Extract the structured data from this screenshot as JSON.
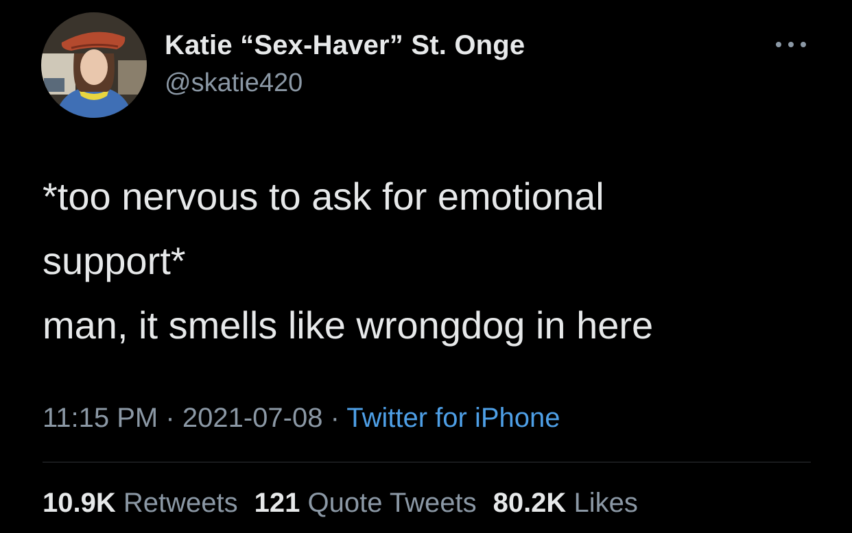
{
  "author": {
    "display_name": "Katie “Sex-Haver” St. Onge",
    "handle": "@skatie420",
    "avatar_icon": "profile-photo"
  },
  "more_icon": "more-horizontal-icon",
  "tweet": {
    "lines": [
      "*too nervous to ask for emotional",
      "support*",
      "man, it smells like wrongdog in here"
    ]
  },
  "meta": {
    "time": "11:15 PM",
    "separator": "·",
    "date": "2021-07-08",
    "source": "Twitter for iPhone"
  },
  "stats": {
    "retweets_count": "10.9K",
    "retweets_label": "Retweets",
    "quotes_count": "121",
    "quotes_label": "Quote Tweets",
    "likes_count": "80.2K",
    "likes_label": "Likes"
  },
  "colors": {
    "background": "#000000",
    "primary_text": "#e7e9ea",
    "secondary_text": "#8b98a5",
    "link": "#4e9fe6",
    "divider": "#2f3336"
  }
}
